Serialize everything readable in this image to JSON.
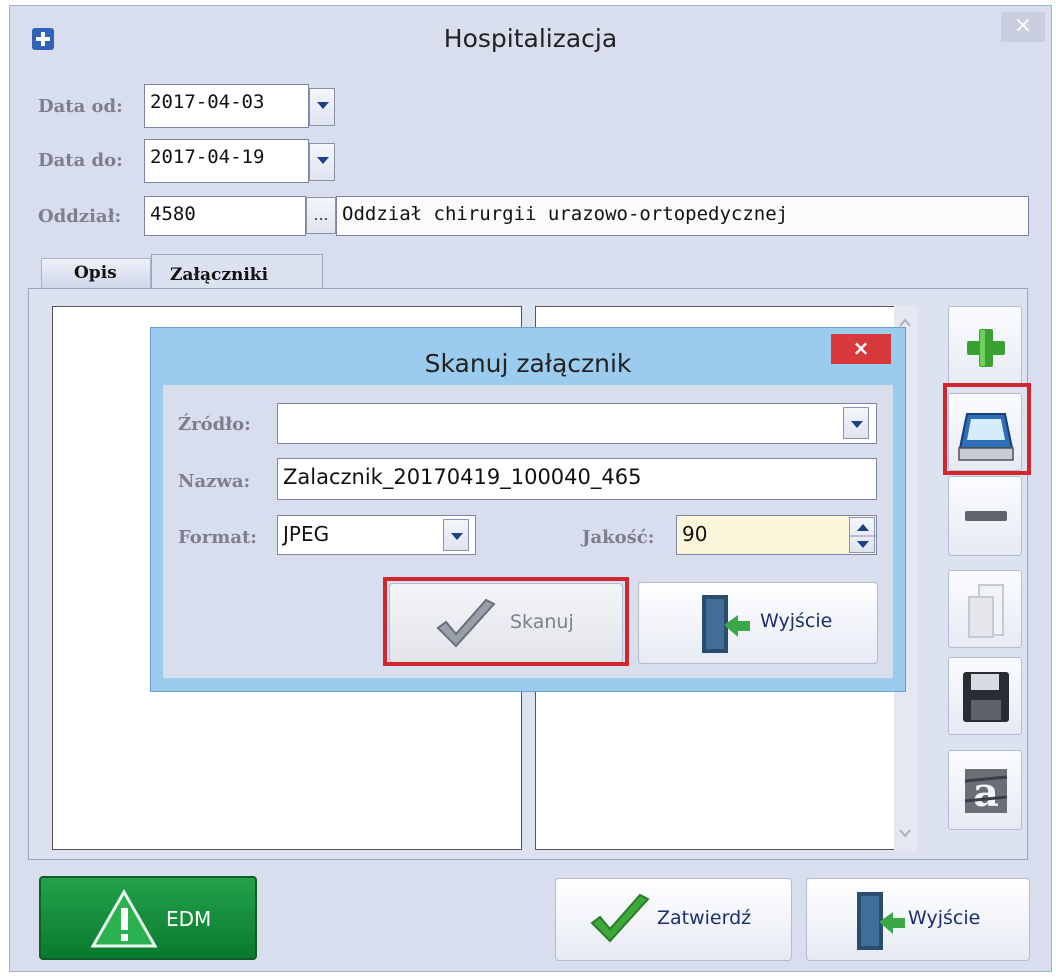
{
  "window": {
    "title": "Hospitalizacja",
    "close_label": "×"
  },
  "form": {
    "date_from_label": "Data od:",
    "date_from_value": "2017-04-03",
    "date_to_label": "Data do:",
    "date_to_value": "2017-04-19",
    "ward_label": "Oddział:",
    "ward_code": "4580",
    "ward_browse": "...",
    "ward_name": "Oddział chirurgii urazowo-ortopedycznej"
  },
  "tabs": [
    {
      "label": "Opis"
    },
    {
      "label": "Załączniki"
    }
  ],
  "dialog": {
    "title": "Skanuj załącznik",
    "close_label": "×",
    "source_label": "Źródło:",
    "source_value": "",
    "name_label": "Nazwa:",
    "name_value": "Zalacznik_20170419_100040_465",
    "format_label": "Format:",
    "format_value": "JPEG",
    "quality_label": "Jakość:",
    "quality_value": "90",
    "scan_button": "Skanuj",
    "exit_button": "Wyjście"
  },
  "footer": {
    "edm_label": "EDM",
    "confirm_label": "Zatwierdź",
    "exit_label": "Wyjście"
  },
  "icons": {
    "add": "plus-icon",
    "scan": "scanner-icon",
    "remove": "minus-icon",
    "open": "file-icon",
    "save": "floppy-disk-icon",
    "ocr": "text-recognition-icon",
    "warning": "warning-icon",
    "check": "checkmark-icon",
    "exit": "door-exit-icon"
  },
  "colors": {
    "highlight_border": "#d0262c",
    "dialog_frame": "#9bcbed",
    "window_bg": "#d9deef",
    "edm_green": "#0a7a2f",
    "quality_field_bg": "#fbf6dc"
  }
}
